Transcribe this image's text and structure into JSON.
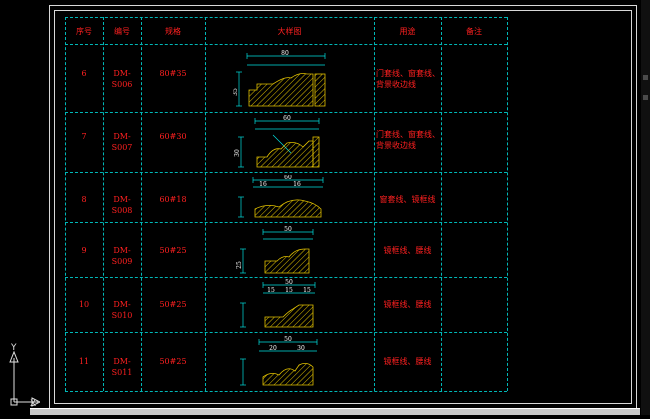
{
  "table": {
    "headers": [
      "序号",
      "编号",
      "规格",
      "大样图",
      "用途",
      "备注"
    ],
    "rows": [
      {
        "no": "6",
        "code": "DM-S006",
        "spec": "80#35",
        "use_lines": [
          "门套线、窗套线、",
          "背景收边线"
        ]
      },
      {
        "no": "7",
        "code": "DM-S007",
        "spec": "60#30",
        "use_lines": [
          "门套线、窗套线、",
          "背景收边线"
        ]
      },
      {
        "no": "8",
        "code": "DM-S008",
        "spec": "60#18",
        "use_lines": [
          "窗套线、镜框线"
        ]
      },
      {
        "no": "9",
        "code": "DM-S009",
        "spec": "50#25",
        "use_lines": [
          "镜框线、腰线"
        ]
      },
      {
        "no": "10",
        "code": "DM-S010",
        "spec": "50#25",
        "use_lines": [
          "镜框线、腰线"
        ]
      },
      {
        "no": "11",
        "code": "DM-S011",
        "spec": "50#25",
        "use_lines": [
          "镜框线、腰线"
        ]
      }
    ]
  },
  "drawings": [
    {
      "name": "profile-drawing-6",
      "dims": [
        "80",
        "35"
      ]
    },
    {
      "name": "profile-drawing-7",
      "dims": [
        "60",
        "30"
      ]
    },
    {
      "name": "profile-drawing-8",
      "dims": [
        "60",
        "16",
        "16"
      ]
    },
    {
      "name": "profile-drawing-9",
      "dims": [
        "50",
        "25"
      ]
    },
    {
      "name": "profile-drawing-10",
      "dims": [
        "50",
        "15",
        "15",
        "15"
      ]
    },
    {
      "name": "profile-drawing-11",
      "dims": [
        "50",
        "20",
        "30"
      ]
    }
  ],
  "ucs": {
    "y_label": "Y",
    "x_label": "X"
  },
  "colors": {
    "grid": "#00b7b7",
    "text": "#ff2020",
    "hatch": "#e0c000",
    "dim": "#00e0e0",
    "frame": "#d8d8d8"
  }
}
